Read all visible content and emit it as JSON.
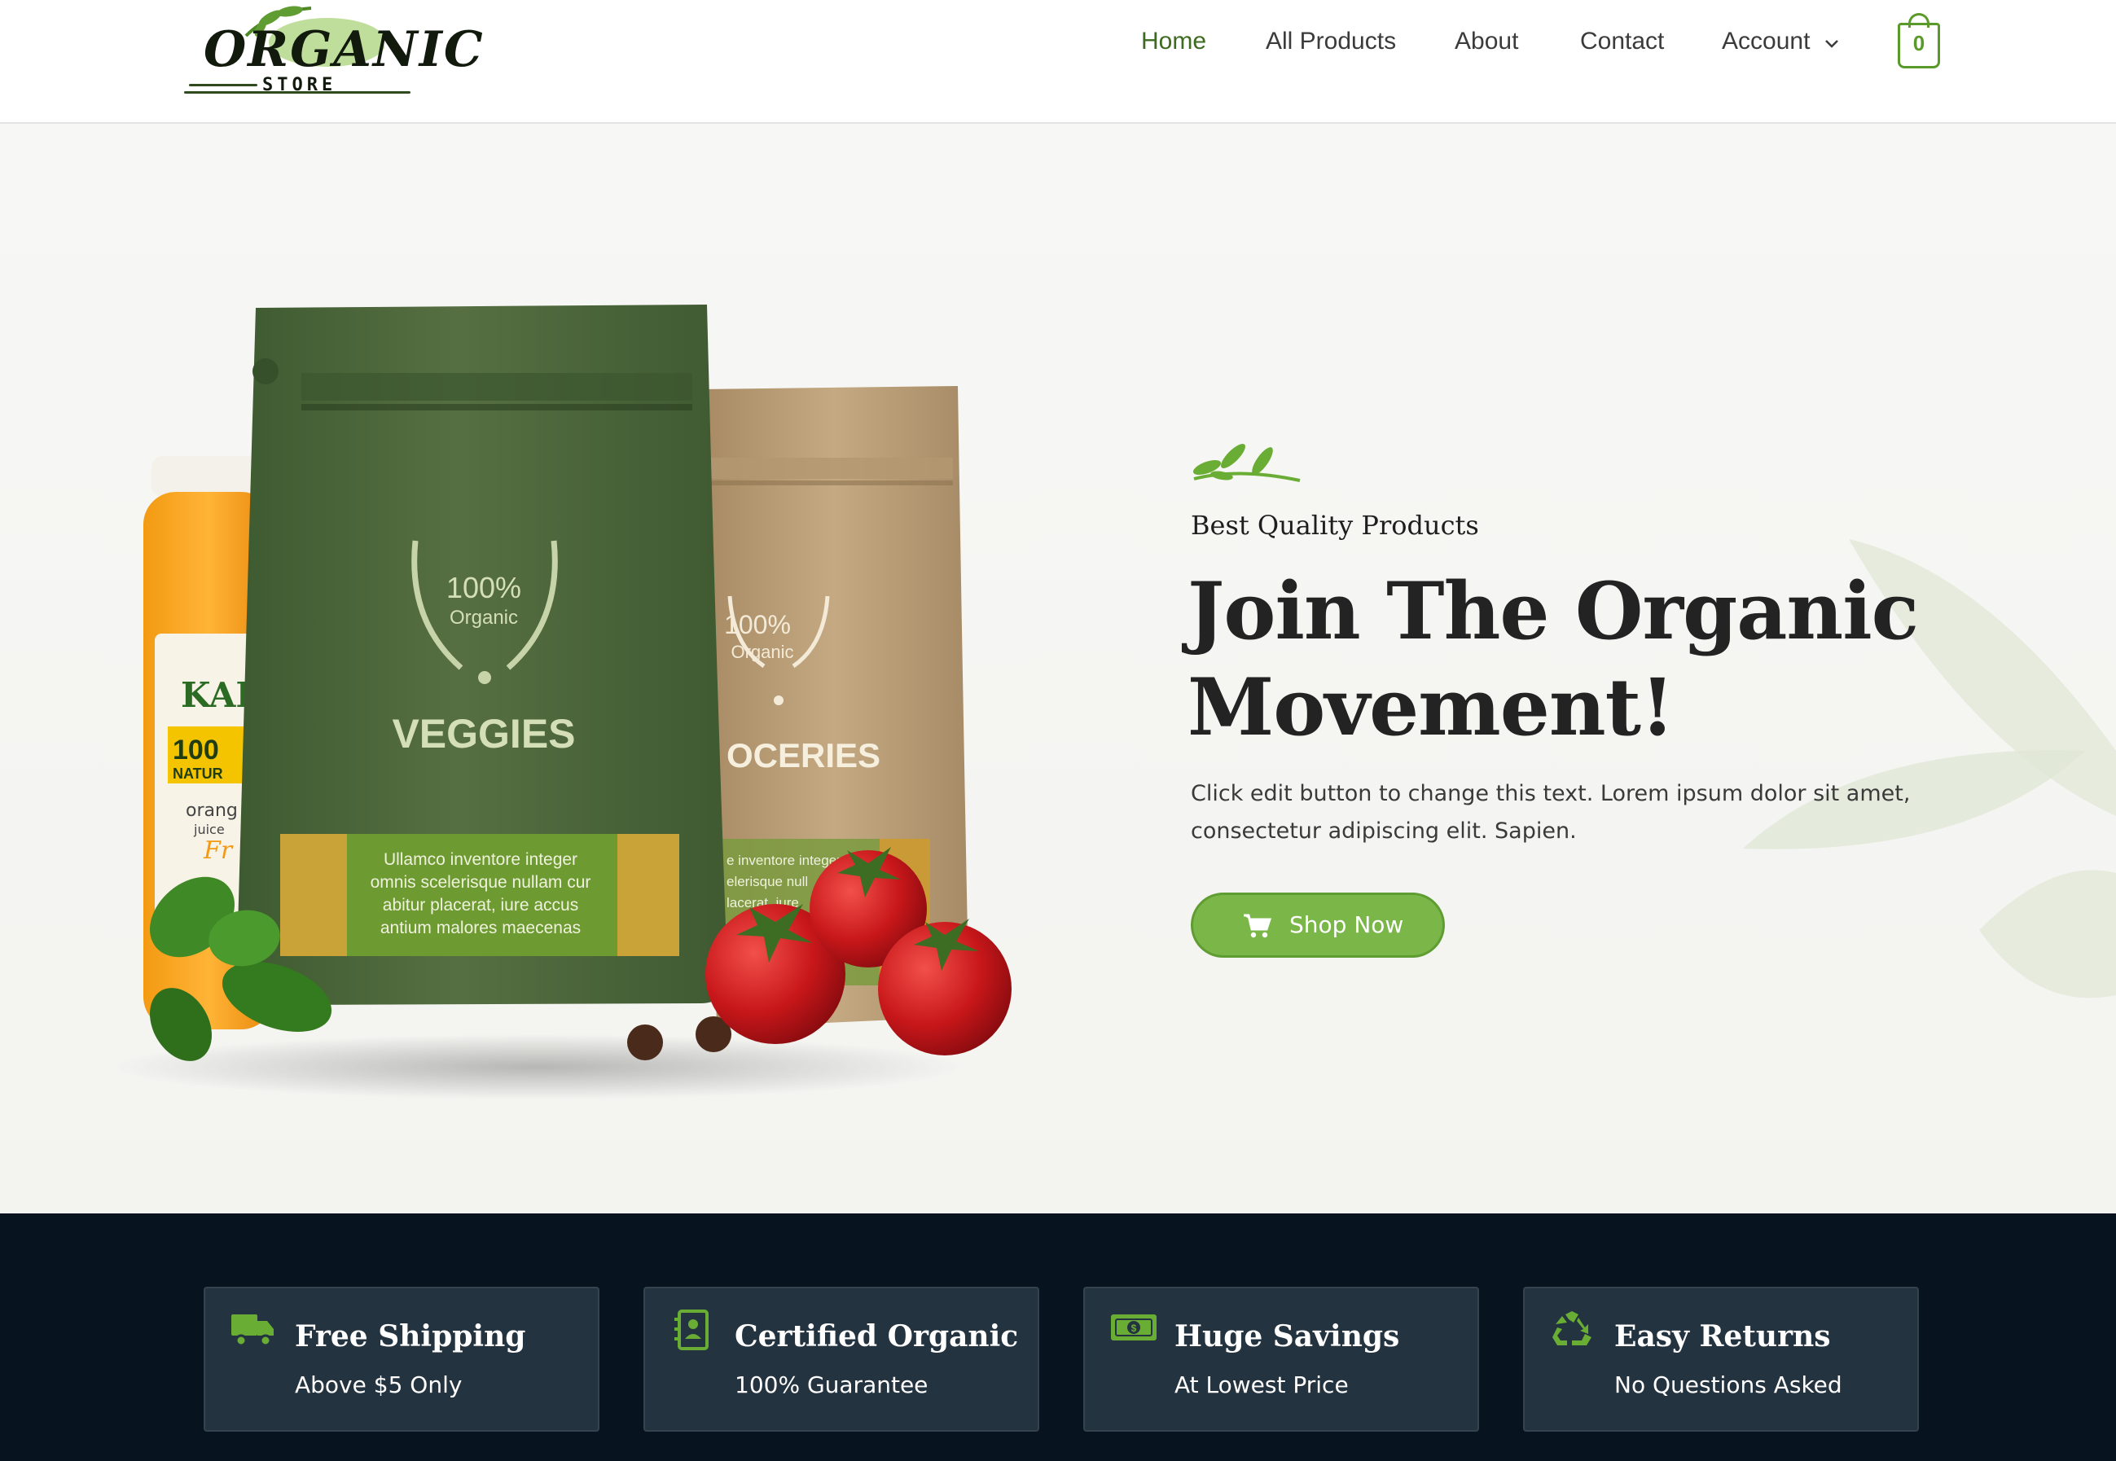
{
  "brand": {
    "logo_word": "ORGANIC",
    "logo_tagline": "STORE",
    "accent_color": "#7ab648",
    "dark_band_color": "#07141f"
  },
  "nav": {
    "items": [
      {
        "label": "Home",
        "active": true
      },
      {
        "label": "All Products",
        "active": false
      },
      {
        "label": "About",
        "active": false
      },
      {
        "label": "Contact",
        "active": false
      },
      {
        "label": "Account",
        "active": false,
        "has_dropdown": true
      }
    ],
    "cart_count": "0",
    "cart_icon": "shopping-bag-icon"
  },
  "hero": {
    "eyebrow": "Best Quality Products",
    "title_line1": "Join The Organic",
    "title_line2": "Movement!",
    "text_line1": "Click edit button to change this text. Lorem ipsum dolor sit amet,",
    "text_line2": "consectetur adipiscing elit. Sapien.",
    "button_label": "Shop Now",
    "button_icon": "cart-icon",
    "product_image": {
      "bag_front": {
        "badge_percent": "100%",
        "badge_word": "Organic",
        "name": "VEGGIES",
        "label_line1": "Ullamco inventore integer",
        "label_line2": "omnis scelerisque nullam cur",
        "label_line3": "abitur placerat, iure accus",
        "label_line4": "antium malores maecenas"
      },
      "bag_back": {
        "badge_percent": "100%",
        "badge_word": "Organic",
        "name": "OCERIES",
        "label_line1": "e inventore integer",
        "label_line2": "elerisque null",
        "label_line3": "lacerat, iure"
      },
      "jar": {
        "brand": "KAR",
        "badge_line1": "100",
        "badge_line2": "NATUR",
        "flavor_line1": "orang",
        "flavor_line2": "juice",
        "script": "Fr"
      }
    }
  },
  "features": [
    {
      "icon": "truck-icon",
      "title": "Free Shipping",
      "subtitle": "Above $5 Only"
    },
    {
      "icon": "certificate-icon",
      "title": "Certified Organic",
      "subtitle": "100% Guarantee"
    },
    {
      "icon": "money-icon",
      "title": "Huge Savings",
      "subtitle": "At Lowest Price"
    },
    {
      "icon": "recycle-icon",
      "title": "Easy Returns",
      "subtitle": "No Questions Asked"
    }
  ]
}
